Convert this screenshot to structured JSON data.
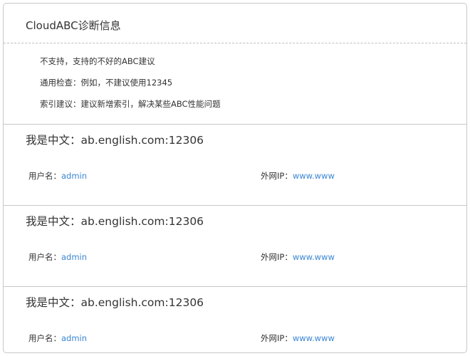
{
  "header": {
    "title": "CloudABC诊断信息"
  },
  "tips": [
    "不支持，支持的不好的ABC建议",
    "通用检查：例如，不建议使用12345",
    "索引建议：建议新增索引，解决某些ABC性能问题"
  ],
  "servers": [
    {
      "title": "我是中文：ab.english.com:12306",
      "username_label": "用户名：",
      "username": "admin",
      "ip_label": "外网IP：",
      "ip": "www.www"
    },
    {
      "title": "我是中文：ab.english.com:12306",
      "username_label": "用户名：",
      "username": "admin",
      "ip_label": "外网IP：",
      "ip": "www.www"
    },
    {
      "title": "我是中文：ab.english.com:12306",
      "username_label": "用户名：",
      "username": "admin",
      "ip_label": "外网IP：",
      "ip": "www.www"
    }
  ],
  "colors": {
    "link": "#3a86d4",
    "text": "#333333",
    "border": "#c8c8c8"
  }
}
